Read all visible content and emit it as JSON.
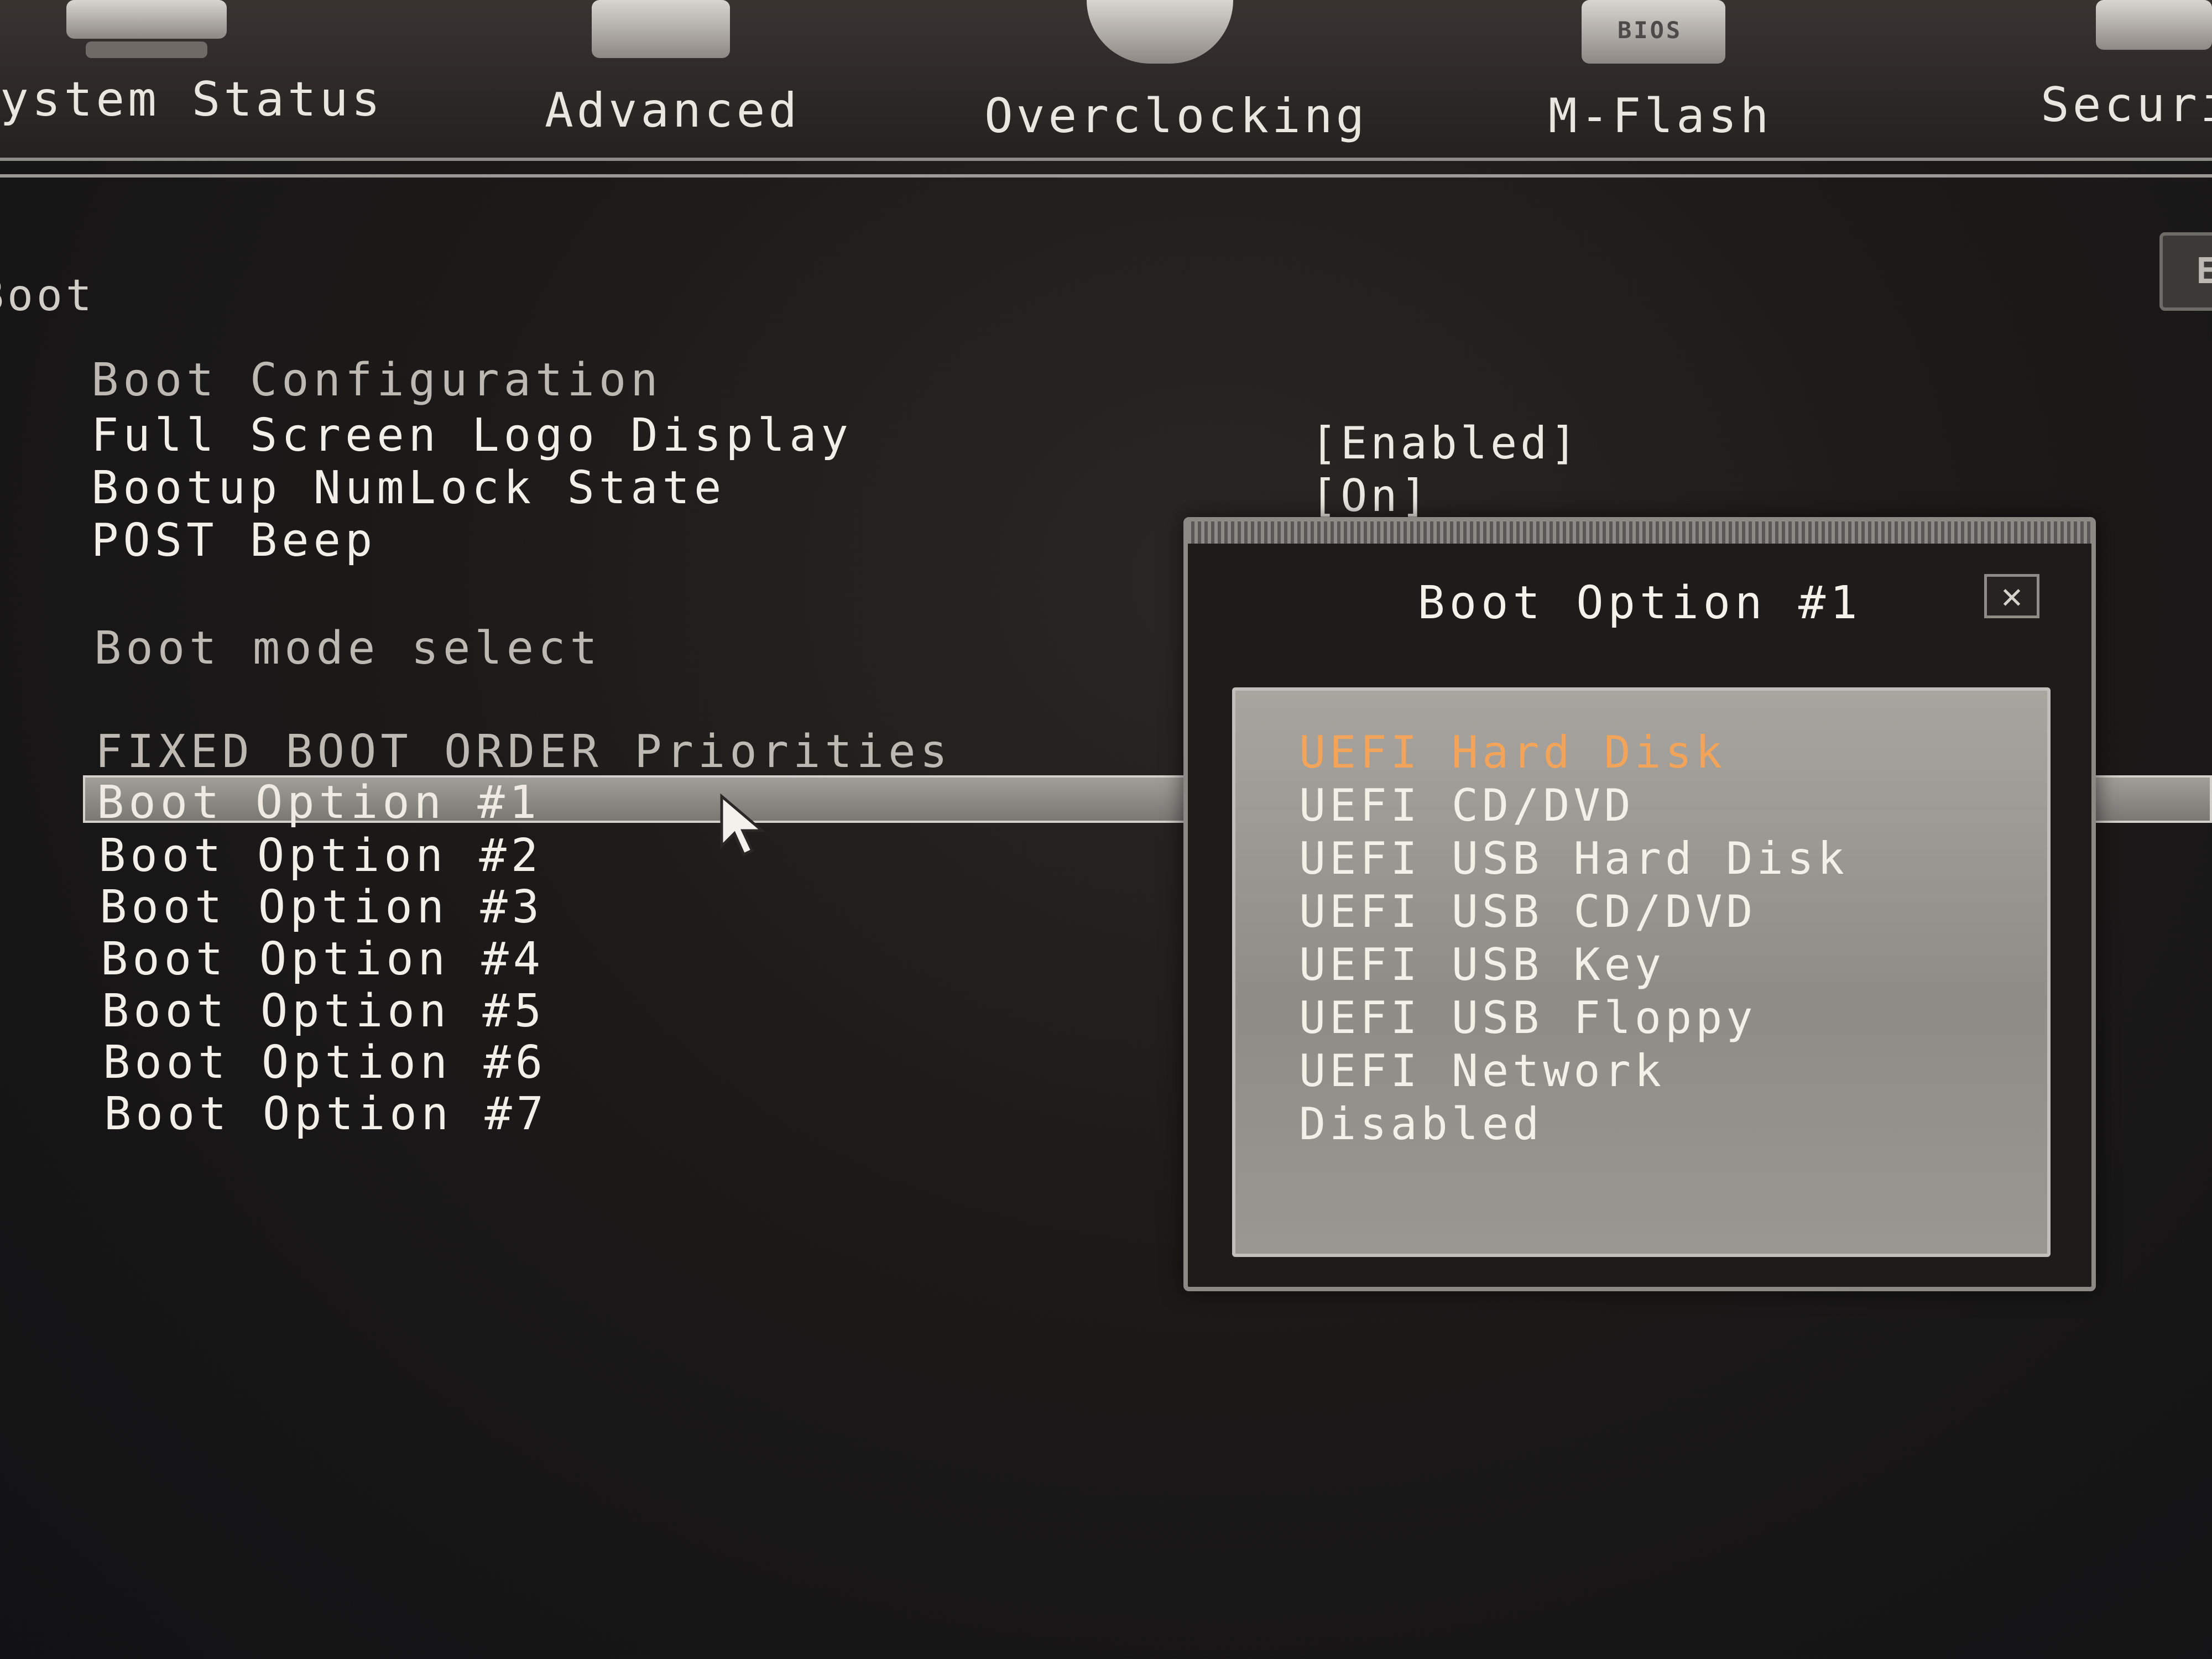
{
  "nav": {
    "tabs": [
      {
        "label": "ystem Status"
      },
      {
        "label": "Advanced"
      },
      {
        "label": "Overclocking"
      },
      {
        "label": "M-Flash",
        "icon_text": "BIOS"
      },
      {
        "label": "Securi"
      }
    ]
  },
  "side_button": {
    "label": "E"
  },
  "section": {
    "title": "Boot"
  },
  "settings": {
    "boot_configuration": "Boot Configuration",
    "full_screen_logo": {
      "label": "Full Screen Logo Display",
      "value": "[Enabled]"
    },
    "numlock": {
      "label": "Bootup NumLock State",
      "value": "[On]"
    },
    "post_beep": {
      "label": "POST Beep"
    },
    "boot_mode_select": "Boot mode select",
    "fixed_boot_order": "FIXED BOOT ORDER Priorities",
    "boot_options": [
      "Boot Option #1",
      "Boot Option #2",
      "Boot Option #3",
      "Boot Option #4",
      "Boot Option #5",
      "Boot Option #6",
      "Boot Option #7"
    ]
  },
  "popup": {
    "title": "Boot Option #1",
    "close_symbol": "✕",
    "options": [
      "UEFI Hard Disk",
      "UEFI CD/DVD",
      "UEFI USB Hard Disk",
      "UEFI USB CD/DVD",
      "UEFI USB Key",
      "UEFI USB Floppy",
      "UEFI Network",
      "Disabled"
    ],
    "highlight_color": "#f2a45a"
  }
}
